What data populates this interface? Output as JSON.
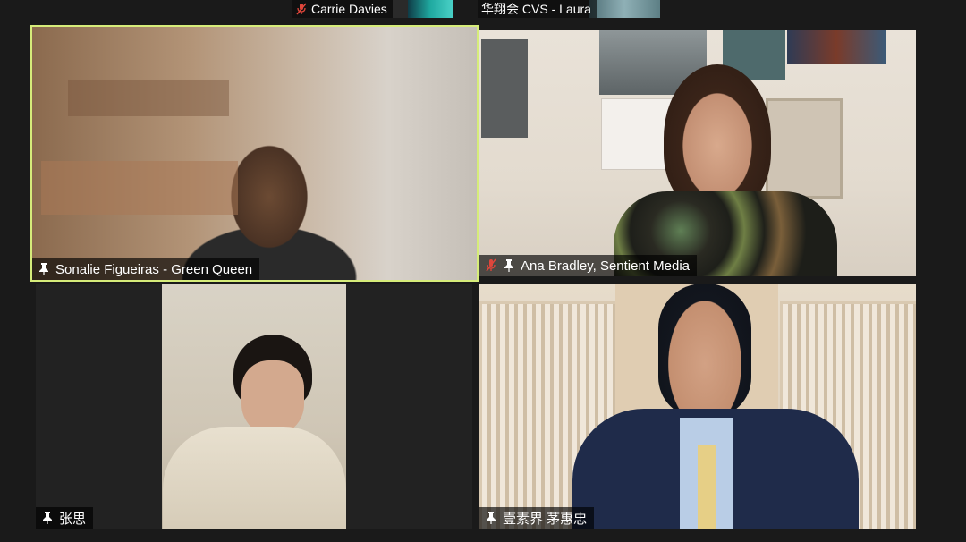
{
  "top_strip": [
    {
      "name": "Carrie Davies",
      "muted": true
    },
    {
      "name": "华翔会 CVS - Laura",
      "muted": false
    }
  ],
  "tiles": [
    {
      "name": "Sonalie Figueiras - Green Queen",
      "pinned": true,
      "muted": false,
      "active": true
    },
    {
      "name": "Ana Bradley, Sentient Media",
      "pinned": true,
      "muted": true,
      "active": false
    },
    {
      "name": "张思",
      "pinned": true,
      "muted": false,
      "active": false
    },
    {
      "name": "壹素界 茅惠忠",
      "pinned": true,
      "muted": false,
      "active": false
    }
  ],
  "colors": {
    "background": "#1a1a1a",
    "active_speaker_border": "#d6ec7a",
    "muted_icon": "#e0463b"
  },
  "icons": {
    "mute": "microphone-muted-icon",
    "pin": "pin-icon"
  }
}
